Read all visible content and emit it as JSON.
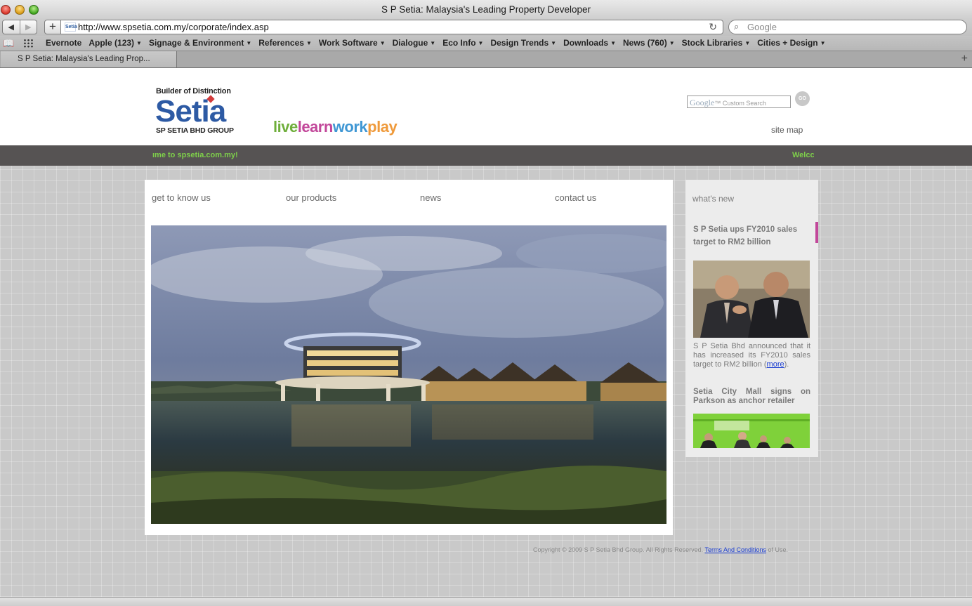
{
  "window": {
    "title": "S P Setia: Malaysia's Leading Property Developer"
  },
  "toolbar": {
    "back_label": "◀",
    "forward_label": "▶",
    "add_label": "+",
    "url": "http://www.spsetia.com.my/corporate/index.asp",
    "favicon_text": "Setia",
    "search_placeholder": "Google"
  },
  "bookmarks": [
    {
      "label": "Evernote",
      "menu": false
    },
    {
      "label": "Apple (123)",
      "menu": true
    },
    {
      "label": "Signage & Environment",
      "menu": true
    },
    {
      "label": "References",
      "menu": true
    },
    {
      "label": "Work Software",
      "menu": true
    },
    {
      "label": "Dialogue",
      "menu": true
    },
    {
      "label": "Eco Info",
      "menu": true
    },
    {
      "label": "Design Trends",
      "menu": true
    },
    {
      "label": "Downloads",
      "menu": true
    },
    {
      "label": "News (760)",
      "menu": true
    },
    {
      "label": "Stock Libraries",
      "menu": true
    },
    {
      "label": "Cities + Design",
      "menu": true
    }
  ],
  "tabs": [
    {
      "label": "S P Setia: Malaysia's Leading Prop..."
    }
  ],
  "site": {
    "logo": {
      "tagline": "Builder of Distinction",
      "name": "Setia",
      "group": "SP SETIA BHD GROUP"
    },
    "slogan": {
      "live": "live",
      "learn": "learn",
      "work": "work",
      "play": "play"
    },
    "search": {
      "brand": "Google",
      "placeholder": "Custom Search",
      "go_label": "GO"
    },
    "site_map": "site map",
    "ticker": {
      "text_a": "ıme to spsetia.com.my!",
      "text_b": "Welcc"
    },
    "nav": [
      "get to know us",
      "our products",
      "news",
      "contact us"
    ],
    "whats_new": {
      "heading": "what's new",
      "item1_title": "S P Setia ups FY2010 sales target to RM2 billion",
      "item1_body": "S P Setia Bhd announced that it has increased its FY2010 sales target to RM2 billion (",
      "item1_more": "more",
      "item1_tail": ").",
      "item2_title": "Setia City Mall signs on Parkson as anchor retailer"
    },
    "footer": {
      "copyright": "Copyright © 2009 S P Setia Bhd Group. All Rights Reserved.",
      "terms_link": "Terms And Conditions",
      "tail": " of Use."
    }
  },
  "colors": {
    "accent_pink": "#c2479a",
    "ticker_green": "#7ed04a",
    "logo_blue": "#2d5aa4",
    "link_blue": "#1a3dd1"
  }
}
